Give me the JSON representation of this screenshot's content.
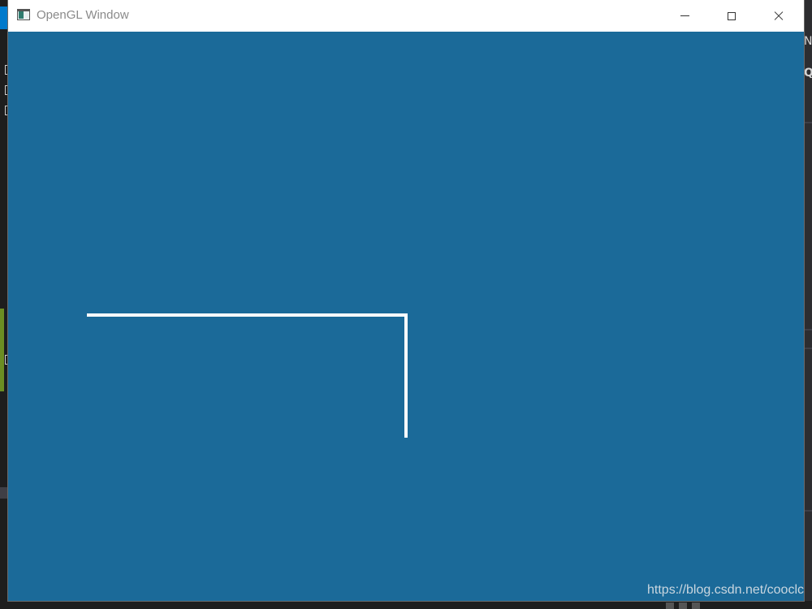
{
  "window": {
    "title": "OpenGL Window",
    "icon": "opengl-app-icon",
    "buttons": {
      "minimize": "minimize-icon",
      "maximize": "maximize-icon",
      "close": "close-icon"
    }
  },
  "viewport": {
    "clear_color": "#1b6a99",
    "line_color": "#ffffff",
    "polyline_description": "white L-shaped line strip"
  },
  "watermark": "https://blog.csdn.net/cooclc",
  "background_ide": {
    "right_edge_text": [
      "NS",
      "Q"
    ]
  }
}
